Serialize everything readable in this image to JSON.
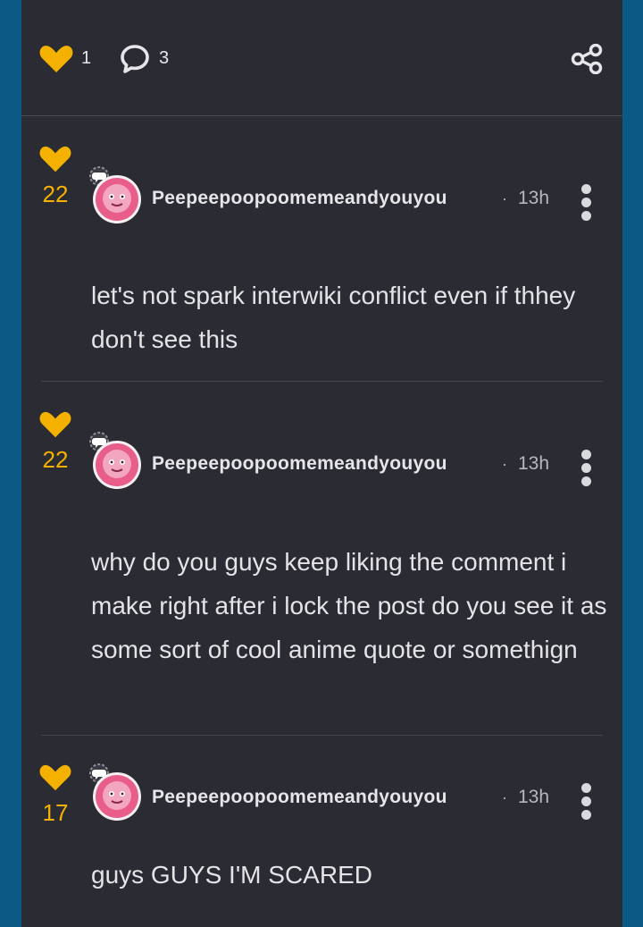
{
  "post_actions": {
    "like_count": "1",
    "comment_count": "3",
    "icons": {
      "like": "heart-icon",
      "comments": "comment-bubble-icon",
      "share": "share-icon"
    }
  },
  "colors": {
    "accent": "#f5b100",
    "panel": "#2a2b33",
    "frame": "#0b5a86"
  },
  "comments": [
    {
      "likes": "22",
      "author": "Peepeepoopoomemeandyouyou",
      "separator": "·",
      "time": "13h",
      "text": " let's not spark interwiki conflict even if thhey don't see this"
    },
    {
      "likes": "22",
      "author": "Peepeepoopoomemeandyouyou",
      "separator": "·",
      "time": "13h",
      "text": "why do you guys keep liking the comment i make right after i lock the post do you see it as some sort of cool anime quote or somethign"
    },
    {
      "likes": "17",
      "author": "Peepeepoopoomemeandyouyou",
      "separator": "·",
      "time": "13h",
      "text": " guys GUYS I'M SCARED"
    }
  ]
}
